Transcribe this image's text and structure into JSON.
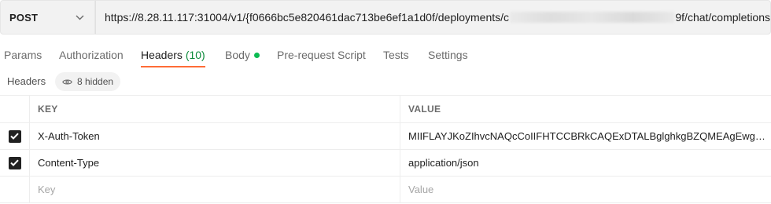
{
  "request": {
    "method": "POST",
    "url_prefix": "https://8.28.11.117:31004/v1/{f0666bc5e820461dac713be6ef1a1d0f/deployments/c",
    "url_suffix": "9f/chat/completions"
  },
  "tabs": [
    {
      "label": "Params"
    },
    {
      "label": "Authorization"
    },
    {
      "label": "Headers",
      "count": "(10)",
      "active": true
    },
    {
      "label": "Body",
      "has_dot": true
    },
    {
      "label": "Pre-request Script"
    },
    {
      "label": "Tests"
    },
    {
      "label": "Settings"
    }
  ],
  "headers_bar": {
    "title": "Headers",
    "hidden_label": "8 hidden"
  },
  "table": {
    "columns": [
      "KEY",
      "VALUE"
    ],
    "rows": [
      {
        "checked": true,
        "key": "X-Auth-Token",
        "value": "MIIFLAYJKoZIhvcNAQcCoIIFHTCCBRkCAQExDTALBglghkgBZQMEAgEwgg..."
      },
      {
        "checked": true,
        "key": "Content-Type",
        "value": "application/json"
      }
    ],
    "new_row": {
      "key_placeholder": "Key",
      "value_placeholder": "Value"
    }
  },
  "colors": {
    "accent": "#ff6c37",
    "count_green": "#0c8a3a",
    "dot_green": "#0cbb52"
  }
}
